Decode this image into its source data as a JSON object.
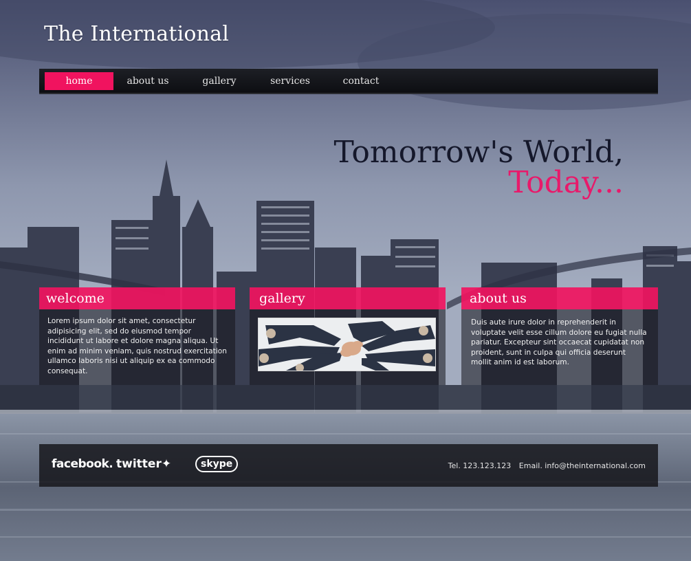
{
  "site": {
    "title": "The International"
  },
  "nav": {
    "items": [
      "home",
      "about us",
      "gallery",
      "services",
      "contact"
    ],
    "active": "home"
  },
  "hero": {
    "line1": "Tomorrow's World,",
    "line2": "Today..."
  },
  "panels": {
    "welcome": {
      "title": "welcome",
      "text": "Lorem ipsum dolor sit amet, consectetur adipisicing elit, sed do eiusmod tempor incididunt ut labore et dolore magna aliqua. Ut enim ad minim veniam, quis nostrud exercitation ullamco laboris nisi ut aliquip ex ea commodo consequat."
    },
    "gallery": {
      "title": "gallery",
      "image_alt": "team-hands-photo"
    },
    "about": {
      "title": "about us",
      "text": "Duis aute irure dolor in reprehenderit in voluptate velit esse cillum dolore eu fugiat nulla pariatur. Excepteur sint occaecat cupidatat non proident, sunt in culpa qui officia deserunt mollit anim id est laborum."
    }
  },
  "footer": {
    "social": [
      "facebook.",
      "twitter",
      "skype"
    ],
    "tel": "Tel. 123.123.123",
    "email": "Email. info@theinternational.com"
  },
  "colors": {
    "accent": "#f0135f",
    "dark": "#15182b"
  }
}
